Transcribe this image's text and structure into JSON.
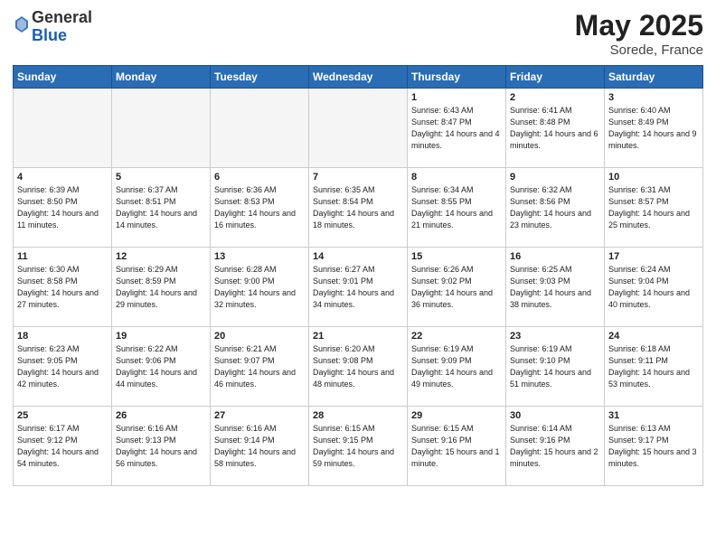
{
  "header": {
    "logo_general": "General",
    "logo_blue": "Blue",
    "title": "May 2025",
    "location": "Sorede, France"
  },
  "days_of_week": [
    "Sunday",
    "Monday",
    "Tuesday",
    "Wednesday",
    "Thursday",
    "Friday",
    "Saturday"
  ],
  "weeks": [
    [
      {
        "day": "",
        "empty": true
      },
      {
        "day": "",
        "empty": true
      },
      {
        "day": "",
        "empty": true
      },
      {
        "day": "",
        "empty": true
      },
      {
        "day": "1",
        "sunrise": "6:43 AM",
        "sunset": "8:47 PM",
        "daylight": "14 hours and 4 minutes."
      },
      {
        "day": "2",
        "sunrise": "6:41 AM",
        "sunset": "8:48 PM",
        "daylight": "14 hours and 6 minutes."
      },
      {
        "day": "3",
        "sunrise": "6:40 AM",
        "sunset": "8:49 PM",
        "daylight": "14 hours and 9 minutes."
      }
    ],
    [
      {
        "day": "4",
        "sunrise": "6:39 AM",
        "sunset": "8:50 PM",
        "daylight": "14 hours and 11 minutes."
      },
      {
        "day": "5",
        "sunrise": "6:37 AM",
        "sunset": "8:51 PM",
        "daylight": "14 hours and 14 minutes."
      },
      {
        "day": "6",
        "sunrise": "6:36 AM",
        "sunset": "8:53 PM",
        "daylight": "14 hours and 16 minutes."
      },
      {
        "day": "7",
        "sunrise": "6:35 AM",
        "sunset": "8:54 PM",
        "daylight": "14 hours and 18 minutes."
      },
      {
        "day": "8",
        "sunrise": "6:34 AM",
        "sunset": "8:55 PM",
        "daylight": "14 hours and 21 minutes."
      },
      {
        "day": "9",
        "sunrise": "6:32 AM",
        "sunset": "8:56 PM",
        "daylight": "14 hours and 23 minutes."
      },
      {
        "day": "10",
        "sunrise": "6:31 AM",
        "sunset": "8:57 PM",
        "daylight": "14 hours and 25 minutes."
      }
    ],
    [
      {
        "day": "11",
        "sunrise": "6:30 AM",
        "sunset": "8:58 PM",
        "daylight": "14 hours and 27 minutes."
      },
      {
        "day": "12",
        "sunrise": "6:29 AM",
        "sunset": "8:59 PM",
        "daylight": "14 hours and 29 minutes."
      },
      {
        "day": "13",
        "sunrise": "6:28 AM",
        "sunset": "9:00 PM",
        "daylight": "14 hours and 32 minutes."
      },
      {
        "day": "14",
        "sunrise": "6:27 AM",
        "sunset": "9:01 PM",
        "daylight": "14 hours and 34 minutes."
      },
      {
        "day": "15",
        "sunrise": "6:26 AM",
        "sunset": "9:02 PM",
        "daylight": "14 hours and 36 minutes."
      },
      {
        "day": "16",
        "sunrise": "6:25 AM",
        "sunset": "9:03 PM",
        "daylight": "14 hours and 38 minutes."
      },
      {
        "day": "17",
        "sunrise": "6:24 AM",
        "sunset": "9:04 PM",
        "daylight": "14 hours and 40 minutes."
      }
    ],
    [
      {
        "day": "18",
        "sunrise": "6:23 AM",
        "sunset": "9:05 PM",
        "daylight": "14 hours and 42 minutes."
      },
      {
        "day": "19",
        "sunrise": "6:22 AM",
        "sunset": "9:06 PM",
        "daylight": "14 hours and 44 minutes."
      },
      {
        "day": "20",
        "sunrise": "6:21 AM",
        "sunset": "9:07 PM",
        "daylight": "14 hours and 46 minutes."
      },
      {
        "day": "21",
        "sunrise": "6:20 AM",
        "sunset": "9:08 PM",
        "daylight": "14 hours and 48 minutes."
      },
      {
        "day": "22",
        "sunrise": "6:19 AM",
        "sunset": "9:09 PM",
        "daylight": "14 hours and 49 minutes."
      },
      {
        "day": "23",
        "sunrise": "6:19 AM",
        "sunset": "9:10 PM",
        "daylight": "14 hours and 51 minutes."
      },
      {
        "day": "24",
        "sunrise": "6:18 AM",
        "sunset": "9:11 PM",
        "daylight": "14 hours and 53 minutes."
      }
    ],
    [
      {
        "day": "25",
        "sunrise": "6:17 AM",
        "sunset": "9:12 PM",
        "daylight": "14 hours and 54 minutes."
      },
      {
        "day": "26",
        "sunrise": "6:16 AM",
        "sunset": "9:13 PM",
        "daylight": "14 hours and 56 minutes."
      },
      {
        "day": "27",
        "sunrise": "6:16 AM",
        "sunset": "9:14 PM",
        "daylight": "14 hours and 58 minutes."
      },
      {
        "day": "28",
        "sunrise": "6:15 AM",
        "sunset": "9:15 PM",
        "daylight": "14 hours and 59 minutes."
      },
      {
        "day": "29",
        "sunrise": "6:15 AM",
        "sunset": "9:16 PM",
        "daylight": "15 hours and 1 minute."
      },
      {
        "day": "30",
        "sunrise": "6:14 AM",
        "sunset": "9:16 PM",
        "daylight": "15 hours and 2 minutes."
      },
      {
        "day": "31",
        "sunrise": "6:13 AM",
        "sunset": "9:17 PM",
        "daylight": "15 hours and 3 minutes."
      }
    ]
  ]
}
